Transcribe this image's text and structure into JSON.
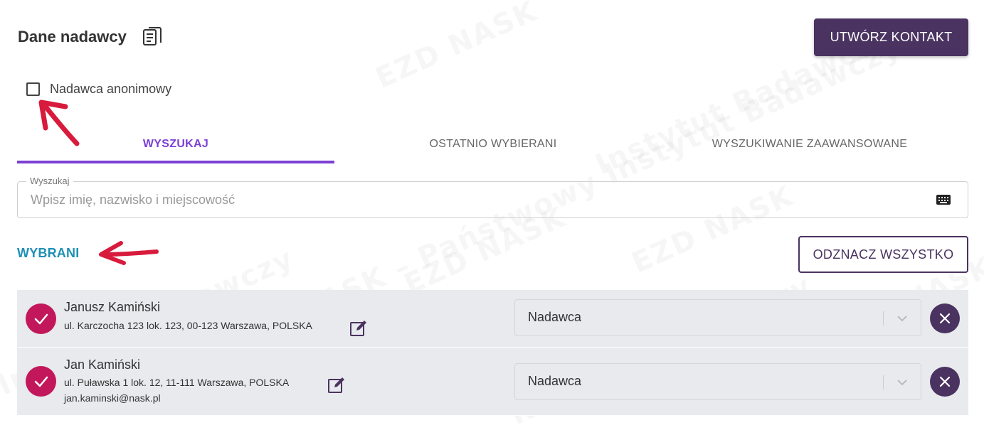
{
  "header": {
    "title": "Dane nadawcy",
    "title_icon": "document-copy-icon",
    "create_button_label": "UTWÓRZ KONTAKT"
  },
  "anonymous": {
    "label": "Nadawca anonimowy",
    "checked": false
  },
  "tabs": [
    {
      "label": "WYSZUKAJ",
      "active": true
    },
    {
      "label": "OSTATNIO WYBIERANI",
      "active": false
    },
    {
      "label": "WYSZUKIWANIE ZAAWANSOWANE",
      "active": false
    }
  ],
  "search": {
    "legend": "Wyszukaj",
    "placeholder": "Wpisz imię, nazwisko i miejscowość",
    "value": "",
    "icon": "keyboard-icon"
  },
  "selected": {
    "title": "WYBRANI",
    "deselect_all_label": "ODZNACZ WSZYSTKO",
    "items": [
      {
        "name": "Janusz Kamiński",
        "address": "ul. Karczocha 123 lok. 123, 00-123 Warszawa, POLSKA",
        "email": "",
        "role": "Nadawca",
        "checked": true
      },
      {
        "name": "Jan Kamiński",
        "address": "ul. Puławska 1 lok. 12, 11-111 Warszawa, POLSKA",
        "email": "jan.kaminski@nask.pl",
        "role": "Nadawca",
        "checked": true
      }
    ]
  },
  "colors": {
    "primary": "#4a3360",
    "tab_active": "#7b3fd4",
    "selected_title": "#1e90b5",
    "check": "#c2185b",
    "annotation_arrow": "#d81b3c"
  }
}
